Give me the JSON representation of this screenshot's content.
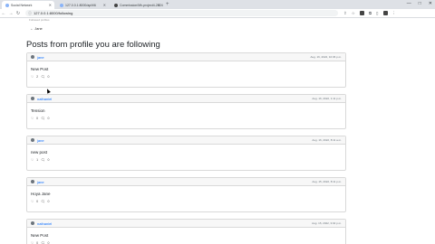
{
  "browser": {
    "tabs": [
      {
        "label": "Social Network",
        "active": true
      },
      {
        "label": "127.0.0.1:8000/api/t/6",
        "active": false
      },
      {
        "label": "Commission/Mh-project4-2024",
        "active": false
      }
    ],
    "address": "127.0.0.1:8000/following",
    "new_tab": "+",
    "back": "←",
    "forward": "→",
    "reload": "↻"
  },
  "page": {
    "top_hint": "Followed profiles",
    "back_link": "← Jane",
    "title": "Posts from profile you are following"
  },
  "posts": [
    {
      "user": "jane",
      "timestamp": "Aug. 16, 2022, 10:36 p.m.",
      "content": "New Post",
      "likes": "2",
      "comments": "0"
    },
    {
      "user": "nathaniel",
      "timestamp": "Aug. 16, 2022, 1:11 p.m.",
      "content": "Tension",
      "likes": "0",
      "comments": "0"
    },
    {
      "user": "jane",
      "timestamp": "Aug. 16, 2022, 8:11 a.m.",
      "content": "new post",
      "likes": "1",
      "comments": "0"
    },
    {
      "user": "jane",
      "timestamp": "Aug. 15, 2022, 8:11 p.m.",
      "content": "Hoya Jane",
      "likes": "0",
      "comments": "0"
    },
    {
      "user": "nathaniel",
      "timestamp": "Aug. 15, 2022, 3:02 p.m.",
      "content": "New Post",
      "likes": "0",
      "comments": "0"
    }
  ]
}
